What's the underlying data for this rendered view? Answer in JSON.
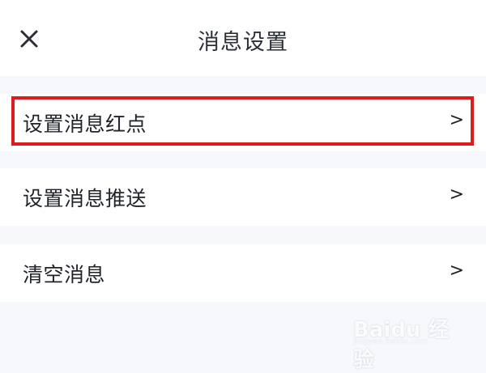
{
  "header": {
    "title": "消息设置",
    "close_icon": "close-icon"
  },
  "settings": {
    "items": [
      {
        "label": "设置消息红点",
        "chevron": ">"
      },
      {
        "label": "设置消息推送",
        "chevron": ">"
      },
      {
        "label": "清空消息",
        "chevron": ">"
      }
    ]
  },
  "highlight": {
    "color": "#e01b1b"
  },
  "watermark": {
    "text": "Baidu 经验",
    "sub": "jingyan.baidu.com"
  }
}
